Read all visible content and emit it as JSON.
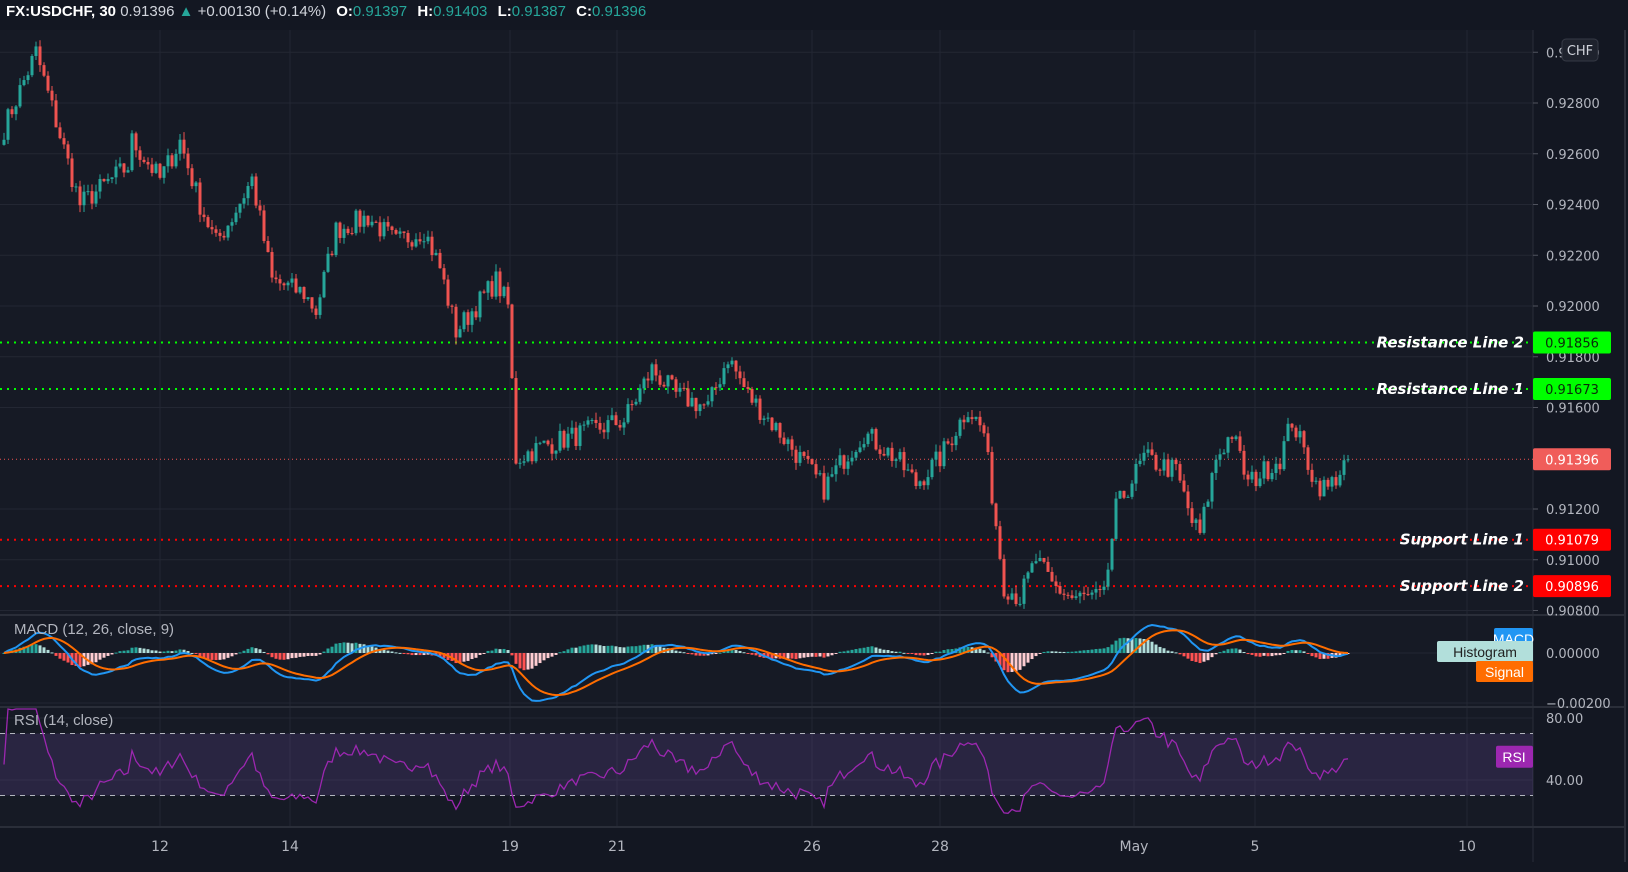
{
  "header": {
    "symbol": "FX:USDCHF, 30",
    "last": "0.91396",
    "change": "+0.00130 (+0.14%)",
    "o_label": "O:",
    "o": "0.91397",
    "h_label": "H:",
    "h": "0.91403",
    "l_label": "L:",
    "l": "0.91387",
    "c_label": "C:",
    "c": "0.91396",
    "direction_icon": "triangle-up-icon"
  },
  "currency_badge": "CHF",
  "colors": {
    "background": "#131722",
    "up": "#26a69a",
    "down": "#ef5350",
    "resistance": "#00ff00",
    "support": "#ff0000",
    "macd": "#2196f3",
    "signal": "#ff6d00",
    "histogram_label": "#b2dfdb",
    "rsi": "#9c27b0"
  },
  "chart_data": {
    "type": "candlestick",
    "interval": "30",
    "price_ticks": [
      "0.93000",
      "0.92800",
      "0.92600",
      "0.92400",
      "0.92200",
      "0.92000",
      "0.91800",
      "0.91600",
      "0.91200",
      "0.91000",
      "0.90800"
    ],
    "price_tick_values": [
      0.93,
      0.928,
      0.926,
      0.924,
      0.922,
      0.92,
      0.918,
      0.916,
      0.912,
      0.91,
      0.908
    ],
    "ylim": [
      0.9078,
      0.9309
    ],
    "x_ticks": [
      "12",
      "14",
      "19",
      "21",
      "26",
      "28",
      "May",
      "5",
      "10"
    ],
    "close_path_by_bar": [
      [
        0,
        0.927
      ],
      [
        8,
        0.93
      ],
      [
        19,
        0.924
      ],
      [
        31,
        0.9255
      ],
      [
        32,
        0.9265
      ],
      [
        39,
        0.925
      ],
      [
        44,
        0.9265
      ],
      [
        49,
        0.924
      ],
      [
        53,
        0.9225
      ],
      [
        57,
        0.9235
      ],
      [
        62,
        0.925
      ],
      [
        67,
        0.921
      ],
      [
        75,
        0.9205
      ],
      [
        78,
        0.9198
      ],
      [
        83,
        0.923
      ],
      [
        91,
        0.9235
      ],
      [
        98,
        0.9225
      ],
      [
        105,
        0.923
      ],
      [
        109,
        0.9215
      ],
      [
        113,
        0.919
      ],
      [
        118,
        0.92
      ],
      [
        123,
        0.921
      ],
      [
        126,
        0.92
      ],
      [
        128,
        0.914
      ],
      [
        135,
        0.9145
      ],
      [
        145,
        0.915
      ],
      [
        155,
        0.9155
      ],
      [
        162,
        0.9175
      ],
      [
        168,
        0.9165
      ],
      [
        176,
        0.916
      ],
      [
        181,
        0.918
      ],
      [
        186,
        0.9165
      ],
      [
        194,
        0.915
      ],
      [
        205,
        0.9128
      ],
      [
        210,
        0.914
      ],
      [
        215,
        0.915
      ],
      [
        223,
        0.914
      ],
      [
        228,
        0.913
      ],
      [
        234,
        0.914
      ],
      [
        241,
        0.916
      ],
      [
        245,
        0.915
      ],
      [
        250,
        0.909
      ],
      [
        254,
        0.9085
      ],
      [
        258,
        0.91
      ],
      [
        262,
        0.909
      ],
      [
        267,
        0.9085
      ],
      [
        275,
        0.9085
      ],
      [
        278,
        0.912
      ],
      [
        285,
        0.914
      ],
      [
        293,
        0.9135
      ],
      [
        297,
        0.9115
      ],
      [
        299,
        0.911
      ],
      [
        303,
        0.914
      ],
      [
        307,
        0.915
      ],
      [
        311,
        0.913
      ],
      [
        319,
        0.914
      ],
      [
        322,
        0.9155
      ],
      [
        328,
        0.913
      ],
      [
        331,
        0.9128
      ],
      [
        336,
        0.91396
      ]
    ],
    "current_price": 0.91396,
    "current_price_label": "0.91396",
    "levels": [
      {
        "name": "Resistance Line 2",
        "value": 0.91856,
        "label": "0.91856",
        "kind": "resistance"
      },
      {
        "name": "Resistance Line 1",
        "value": 0.91673,
        "label": "0.91673",
        "kind": "resistance"
      },
      {
        "name": "Support Line 1",
        "value": 0.91079,
        "label": "0.91079",
        "kind": "support"
      },
      {
        "name": "Support Line 2",
        "value": 0.90896,
        "label": "0.90896",
        "kind": "support"
      }
    ],
    "macd": {
      "legend": "MACD (12, 26, close, 9)",
      "fast": 12,
      "slow": 26,
      "signal": 9,
      "ticks": [
        "0.00000",
        "−0.00200"
      ],
      "tick_values": [
        0,
        -0.002
      ],
      "tags": {
        "macd": "MACD",
        "histogram": "Histogram",
        "signal": "Signal"
      }
    },
    "rsi": {
      "legend": "RSI (14, close)",
      "length": 14,
      "ticks": [
        "80.00",
        "40.00"
      ],
      "tick_values": [
        80,
        40
      ],
      "bands": [
        70,
        30
      ],
      "tag": "RSI"
    }
  }
}
